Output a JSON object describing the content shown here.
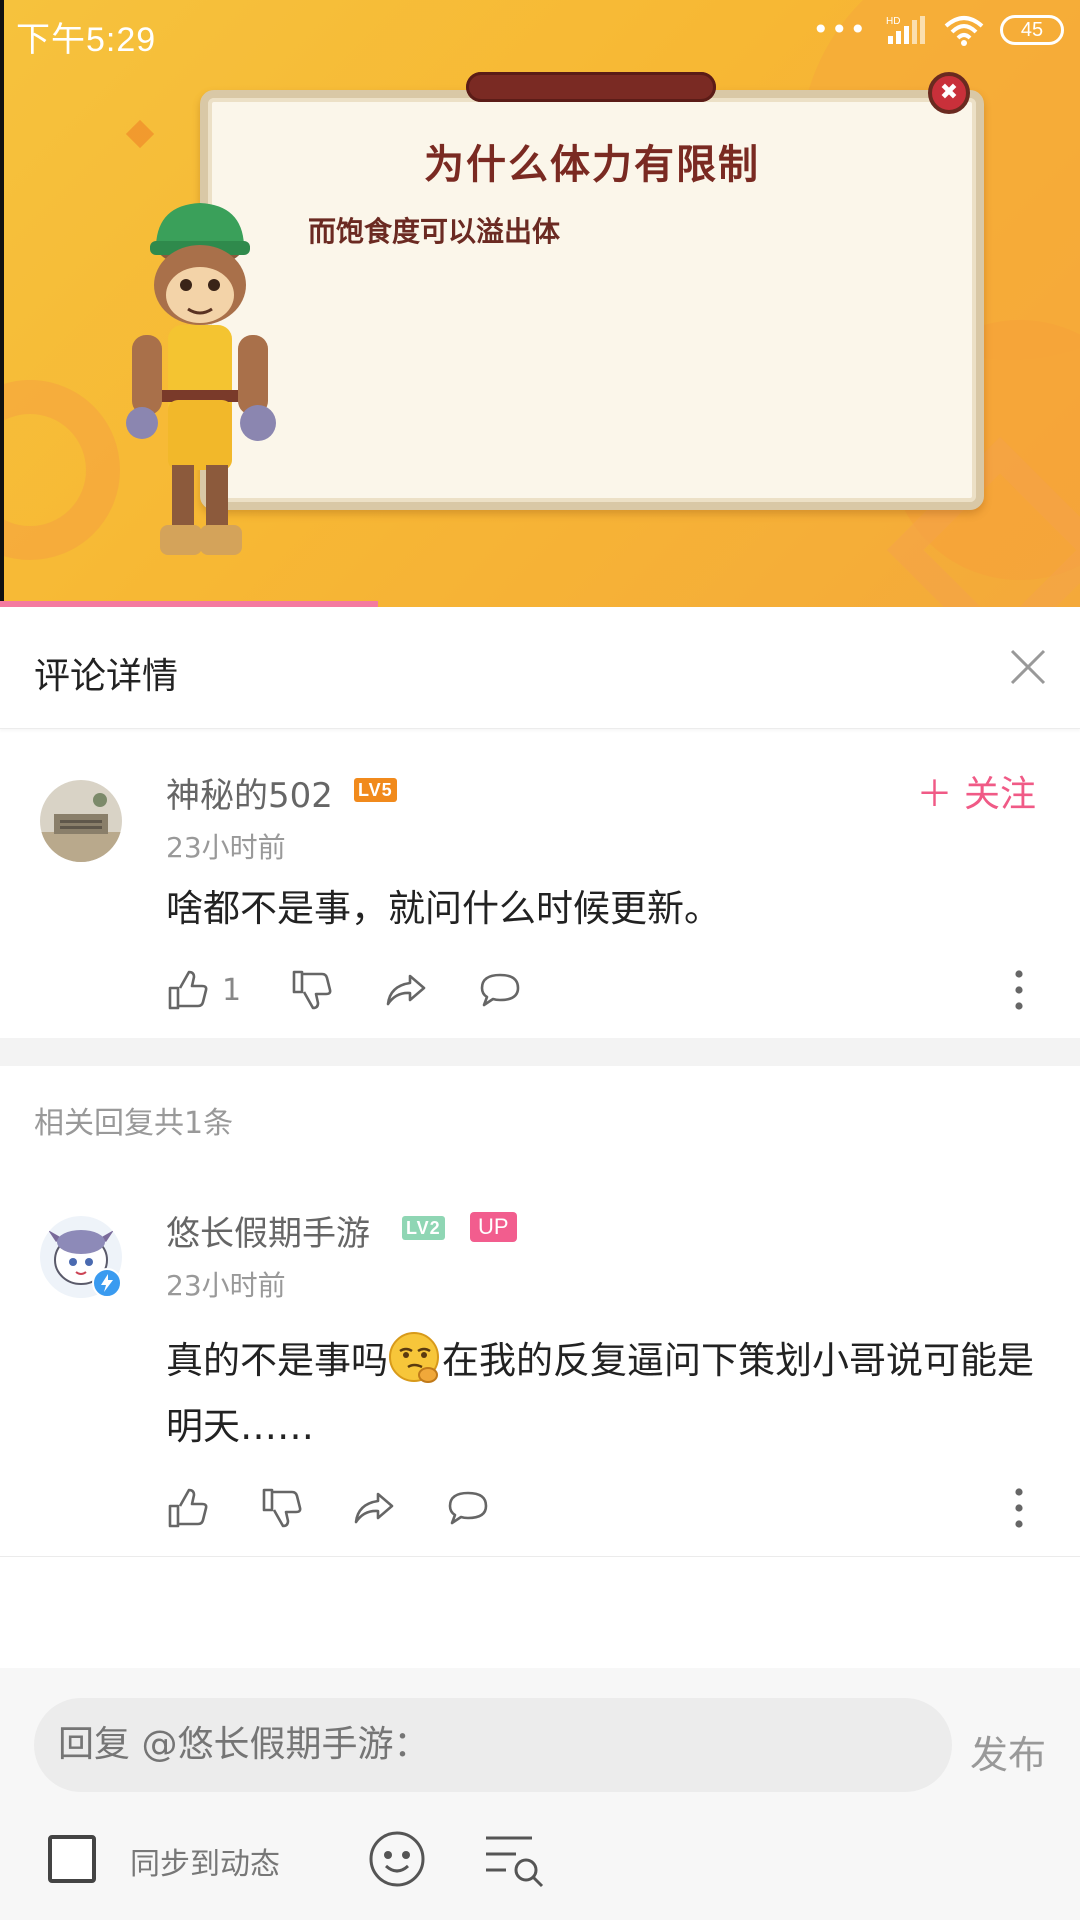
{
  "status_bar": {
    "time": "下午5:29",
    "network": "HD",
    "battery": "45"
  },
  "video": {
    "panel_title": "为什么体力有限制",
    "panel_text": "而饱食度可以溢出体",
    "progress": 0.35
  },
  "header": {
    "title": "评论详情"
  },
  "main_comment": {
    "username": "神秘的502",
    "level": "LV5",
    "time": "23小时前",
    "content": "啥都不是事，就问什么时候更新。",
    "like_count": "1",
    "follow_label": "＋ 关注"
  },
  "replies_section": {
    "label": "相关回复共1条"
  },
  "reply": {
    "username": "悠长假期手游",
    "level": "LV2",
    "badge": "UP",
    "time": "23小时前",
    "content_before": "真的不是事吗",
    "content_after": "在我的反复逼问下策划小哥说可能是明天……"
  },
  "reply_bar": {
    "placeholder": "回复 @悠长假期手游：",
    "publish_label": "发布",
    "sync_label": "同步到动态"
  },
  "colors": {
    "accent_pink": "#f05a86",
    "lv5": "#f18a1c",
    "lv2": "#8fd6b4"
  }
}
